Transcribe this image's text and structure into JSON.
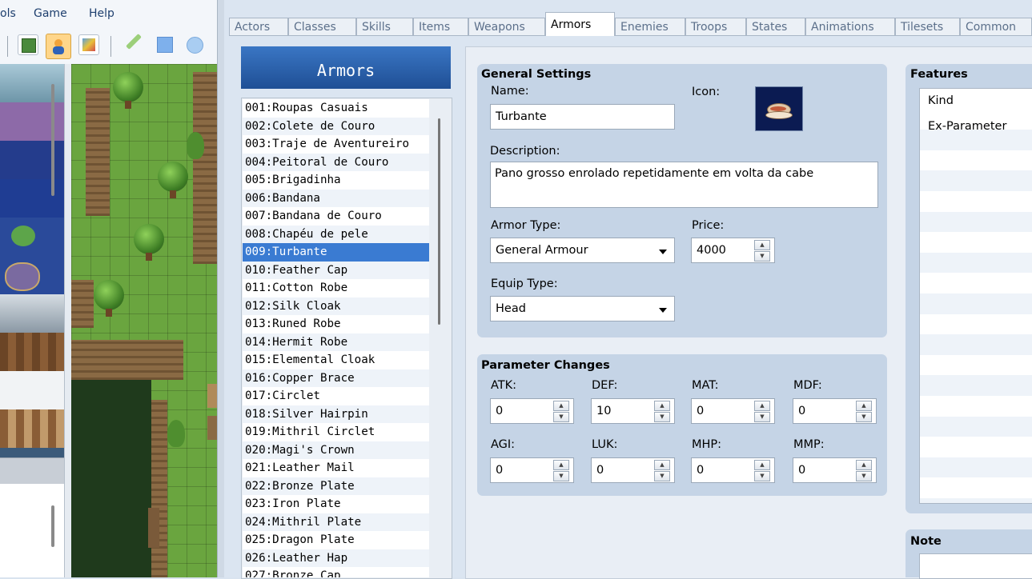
{
  "menubar": {
    "items": [
      "ols",
      "Game",
      "Help"
    ]
  },
  "toolbar": {
    "icons": [
      "map-icon",
      "character-icon",
      "tileset-icon",
      "pencil-icon",
      "rectangle-icon",
      "ellipse-icon"
    ]
  },
  "database": {
    "tabs": [
      "Actors",
      "Classes",
      "Skills",
      "Items",
      "Weapons",
      "Armors",
      "Enemies",
      "Troops",
      "States",
      "Animations",
      "Tilesets",
      "Common"
    ],
    "active_tab": "Armors",
    "list_title": "Armors",
    "list": [
      "001:Roupas Casuais",
      "002:Colete de Couro",
      "003:Traje de Aventureiro",
      "004:Peitoral de Couro",
      "005:Brigadinha",
      "006:Bandana",
      "007:Bandana de Couro",
      "008:Chapéu de pele",
      "009:Turbante",
      "010:Feather Cap",
      "011:Cotton Robe",
      "012:Silk Cloak",
      "013:Runed Robe",
      "014:Hermit Robe",
      "015:Elemental Cloak",
      "016:Copper Brace",
      "017:Circlet",
      "018:Silver Hairpin",
      "019:Mithril Circlet",
      "020:Magi's Crown",
      "021:Leather Mail",
      "022:Bronze Plate",
      "023:Iron Plate",
      "024:Mithril Plate",
      "025:Dragon Plate",
      "026:Leather Hap",
      "027:Bronze Cap"
    ],
    "selected_index": 8
  },
  "general": {
    "title": "General Settings",
    "name_label": "Name:",
    "name_value": "Turbante",
    "icon_label": "Icon:",
    "icon_name": "turban-icon",
    "description_label": "Description:",
    "description_value": "Pano grosso enrolado repetidamente em volta da cabe",
    "armor_type_label": "Armor Type:",
    "armor_type_value": "General Armour",
    "price_label": "Price:",
    "price_value": "4000",
    "equip_type_label": "Equip Type:",
    "equip_type_value": "Head"
  },
  "params": {
    "title": "Parameter Changes",
    "fields": [
      {
        "label": "ATK:",
        "value": "0"
      },
      {
        "label": "DEF:",
        "value": "10"
      },
      {
        "label": "MAT:",
        "value": "0"
      },
      {
        "label": "MDF:",
        "value": "0"
      },
      {
        "label": "AGI:",
        "value": "0"
      },
      {
        "label": "LUK:",
        "value": "0"
      },
      {
        "label": "MHP:",
        "value": "0"
      },
      {
        "label": "MMP:",
        "value": "0"
      }
    ]
  },
  "features": {
    "title": "Features",
    "header": "Kind",
    "rows": [
      "Ex-Parameter"
    ]
  },
  "note": {
    "title": "Note"
  },
  "colors": {
    "selection": "#3a7bd2",
    "title_bar": "#2a63ad",
    "group_bg": "#c5d4e6"
  }
}
